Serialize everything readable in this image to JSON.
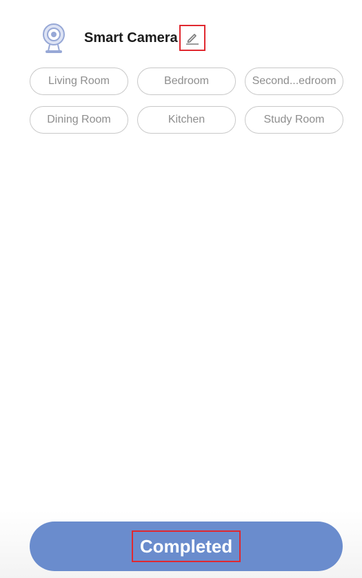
{
  "device": {
    "name": "Smart Camera",
    "icon": "camera-icon",
    "edit_icon": "pencil-icon"
  },
  "rooms": [
    "Living Room",
    "Bedroom",
    "Second...edroom",
    "Dining Room",
    "Kitchen",
    "Study Room"
  ],
  "footer": {
    "complete_label": "Completed"
  },
  "colors": {
    "accent": "#6a8ccd",
    "highlight": "#e0282f",
    "chip_border": "#c8c8c8",
    "chip_text": "#8e8e8e"
  }
}
